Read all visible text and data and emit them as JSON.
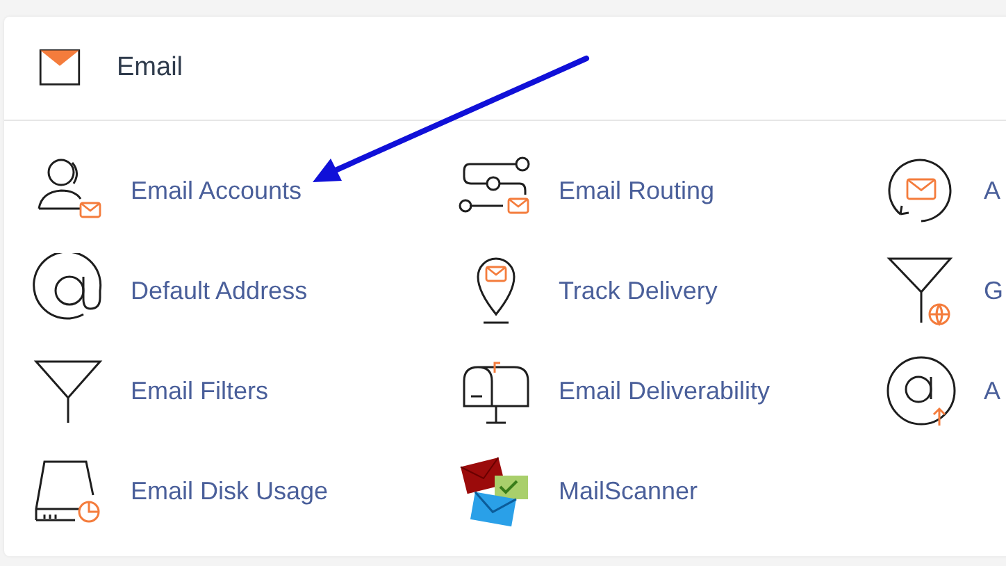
{
  "section": {
    "title": "Email"
  },
  "items": [
    {
      "label": "Email Accounts"
    },
    {
      "label": "Email Routing"
    },
    {
      "label": "A"
    },
    {
      "label": "Default Address"
    },
    {
      "label": "Track Delivery"
    },
    {
      "label": "G"
    },
    {
      "label": "Email Filters"
    },
    {
      "label": "Email Deliverability"
    },
    {
      "label": "A"
    },
    {
      "label": "Email Disk Usage"
    },
    {
      "label": "MailScanner"
    }
  ]
}
